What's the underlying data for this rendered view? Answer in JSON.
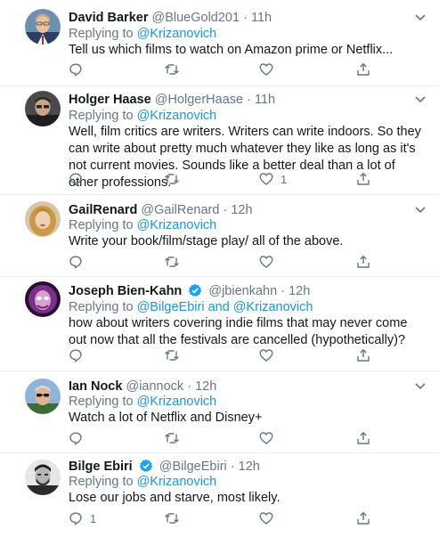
{
  "tweets": [
    {
      "name": "David Barker",
      "handle": "@BlueGold201",
      "time": "11h",
      "reply_prefix": "Replying to",
      "reply_to": "@Krizanovich",
      "text": "Tell us which films to watch on Amazon prime or Netflix...",
      "likes": "",
      "replies": "",
      "verified": false,
      "avatar": "man-glasses-suit"
    },
    {
      "name": "Holger Haase",
      "handle": "@HolgerHaase",
      "time": "11h",
      "reply_prefix": "Replying to",
      "reply_to": "@Krizanovich",
      "text": "Well, film critics are writers. Writers can write indoors. So they can write about pretty much whatever they like as long as it's not current movies. Sounds like a better deal than a lot of other professions.",
      "likes": "1",
      "replies": "",
      "verified": false,
      "avatar": "man-glasses-dark"
    },
    {
      "name": "GailRenard",
      "handle": "@GailRenard",
      "time": "12h",
      "reply_prefix": "Replying to",
      "reply_to": "@Krizanovich",
      "text": "Write your book/film/stage play/ all of the above.",
      "likes": "",
      "replies": "",
      "verified": false,
      "avatar": "woman-blonde"
    },
    {
      "name": "Joseph Bien-Kahn",
      "handle": "@jbienkahn",
      "time": "12h",
      "reply_prefix": "Replying to",
      "reply_to": "@BilgeEbiri and @Krizanovich",
      "text": "how about writers covering indie films that may never come out now that all the festivals are cancelled (hypothetically)?",
      "likes": "",
      "replies": "",
      "verified": true,
      "avatar": "man-purple-light"
    },
    {
      "name": "Ian Nock",
      "handle": "@iannock",
      "time": "12h",
      "reply_prefix": "Replying to",
      "reply_to": "@Krizanovich",
      "text": "Watch a lot of Netflix and Disney+",
      "likes": "",
      "replies": "",
      "verified": false,
      "avatar": "man-sunglasses-outdoor"
    },
    {
      "name": "Bilge Ebiri",
      "handle": "@BilgeEbiri",
      "time": "12h",
      "reply_prefix": "Replying to",
      "reply_to": "@Krizanovich",
      "text": "Lose our jobs and starve, most likely.",
      "likes": "",
      "replies": "1",
      "verified": true,
      "avatar": "man-beard-bw"
    }
  ],
  "icons": {
    "reply": "reply-icon",
    "retweet": "retweet-icon",
    "like": "heart-icon",
    "share": "share-icon",
    "menu": "chevron-down-icon",
    "verified": "verified-badge-icon"
  },
  "colors": {
    "link": "#1b95e0",
    "meta": "#657786",
    "text": "#14171a",
    "border": "#e6ecf0",
    "verified": "#1da1f2"
  }
}
